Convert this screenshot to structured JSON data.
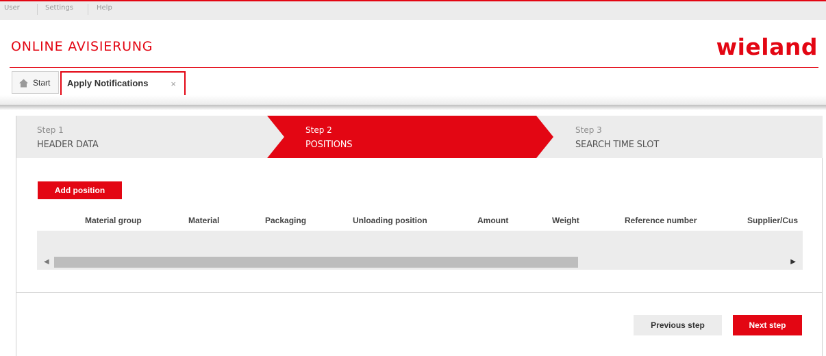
{
  "top_menu": {
    "items": [
      "User",
      "Settings",
      "Help"
    ]
  },
  "header": {
    "app_title": "ONLINE AVISIERUNG",
    "logo_text": "wieland"
  },
  "tabs": {
    "start_label": "Start",
    "start_icon": "home-icon",
    "active_label": "Apply Notifications",
    "close_symbol": "×"
  },
  "wizard": {
    "steps": [
      {
        "number": "Step 1",
        "name": "HEADER DATA",
        "active": false
      },
      {
        "number": "Step 2",
        "name": "POSITIONS",
        "active": true
      },
      {
        "number": "Step 3",
        "name": "SEARCH TIME SLOT",
        "active": false
      }
    ]
  },
  "positions": {
    "add_button": "Add position",
    "columns": [
      "Material group",
      "Material",
      "Packaging",
      "Unloading position",
      "Amount",
      "Weight",
      "Reference number",
      "Supplier/Cus"
    ],
    "rows": []
  },
  "footer": {
    "previous_button": "Previous step",
    "next_button": "Next step"
  },
  "colors": {
    "accent": "#e30613",
    "panel_gray": "#ececec",
    "text_dark": "#333333"
  }
}
